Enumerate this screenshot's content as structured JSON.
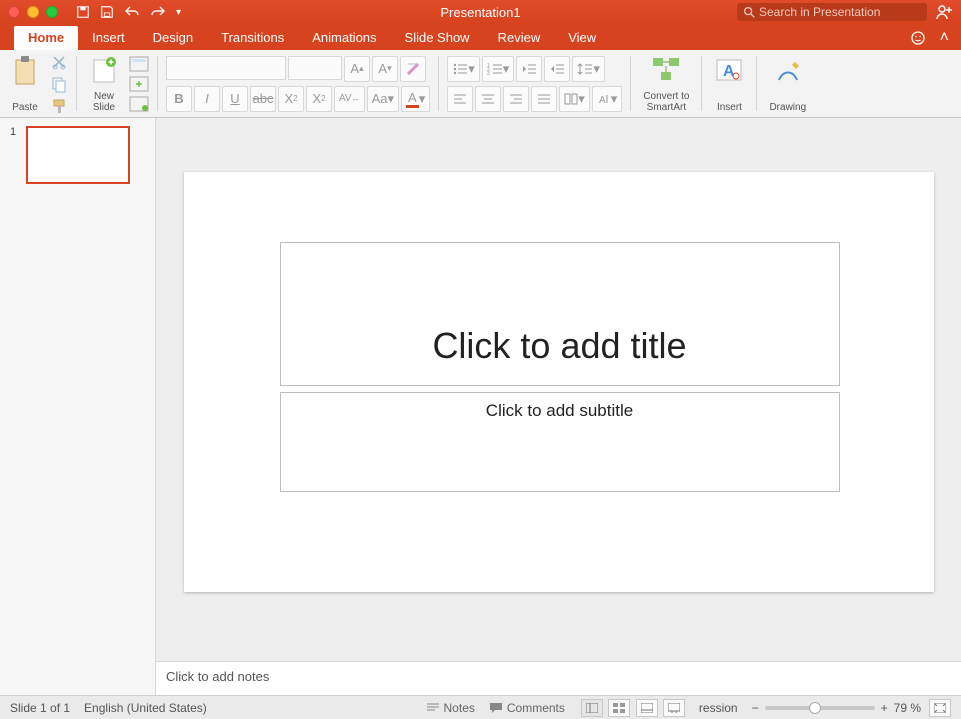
{
  "title": "Presentation1",
  "search_placeholder": "Search in Presentation",
  "tabs": {
    "home": "Home",
    "insert": "Insert",
    "design": "Design",
    "transitions": "Transitions",
    "animations": "Animations",
    "slideshow": "Slide Show",
    "review": "Review",
    "view": "View"
  },
  "ribbon": {
    "paste": "Paste",
    "new_slide": "New\nSlide",
    "convert": "Convert to\nSmartArt",
    "insert": "Insert",
    "drawing": "Drawing"
  },
  "thumbs": {
    "slide1_num": "1"
  },
  "placeholders": {
    "title": "Click to add title",
    "subtitle": "Click to add subtitle"
  },
  "notes_placeholder": "Click to add notes",
  "status": {
    "slide": "Slide 1 of 1",
    "lang": "English (United States)",
    "notes": "Notes",
    "comments": "Comments",
    "zoom": "79 %"
  }
}
